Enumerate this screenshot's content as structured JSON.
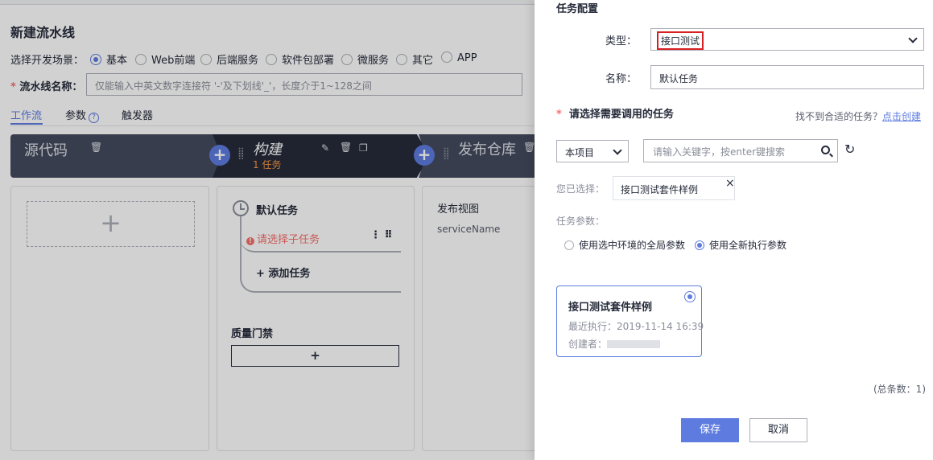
{
  "page": {
    "title": "新建流水线",
    "scene_label": "选择开发场景：",
    "scenes": [
      "基本",
      "Web前端",
      "后端服务",
      "软件包部署",
      "微服务",
      "其它",
      "APP"
    ],
    "selected_scene": "基本",
    "name_label": "流水线名称：",
    "name_placeholder": "仅能输入中英文数字连接符 '-'及下划线'_'，长度介于1~128之间",
    "tabs": [
      "工作流",
      "参数",
      "触发器"
    ],
    "active_tab": "工作流",
    "help_glyph": "?"
  },
  "stages": [
    {
      "name": "源代码",
      "icon": "trash-icon"
    },
    {
      "name": "构建",
      "count": "1 任务",
      "icons": [
        "edit-icon",
        "trash-icon",
        "copy-icon"
      ]
    },
    {
      "name": "发布仓库",
      "icon": "trash-icon"
    }
  ],
  "panels": {
    "source_add": "+",
    "job_title": "默认任务",
    "job_warning": "请选择子任务",
    "warn_glyph": "!",
    "more_glyph": "⋮ ⠿",
    "add_task": "+ 添加任务",
    "gate_title": "质量门禁",
    "gate_add": "+",
    "publish_title": "发布视图",
    "publish_sub": "serviceName"
  },
  "drawer": {
    "title": "任务配置",
    "type_label": "类型：",
    "type_value": "接口测试",
    "name_label": "名称：",
    "name_value": "默认任务",
    "section_title": "请选择需要调用的任务",
    "not_found_text": "找不到合适的任务？",
    "not_found_link": "点击创建",
    "project_select": "本项目",
    "search_placeholder": "请输入关键字，按enter键搜索",
    "refresh_glyph": "↻",
    "selected_label": "您已选择：",
    "selected_chip": "接口测试套件样例",
    "chip_close": "×",
    "params_label": "任务参数：",
    "param_options": [
      "使用选中环境的全局参数",
      "使用全新执行参数"
    ],
    "param_selected": "使用全新执行参数",
    "card": {
      "title": "接口测试套件样例",
      "last_run": "最近执行：2019-11-14 16:39",
      "creator": "创建者："
    },
    "total": "(总条数：1)",
    "save_label": "保存",
    "cancel_label": "取消"
  },
  "colors": {
    "accent": "#5e7ce0",
    "warning": "#f66f6a",
    "stage_dark": "#252b3a",
    "stage_gray": "#454b5e",
    "count_orange": "#fa9841",
    "highlight_box": "#d62024"
  }
}
